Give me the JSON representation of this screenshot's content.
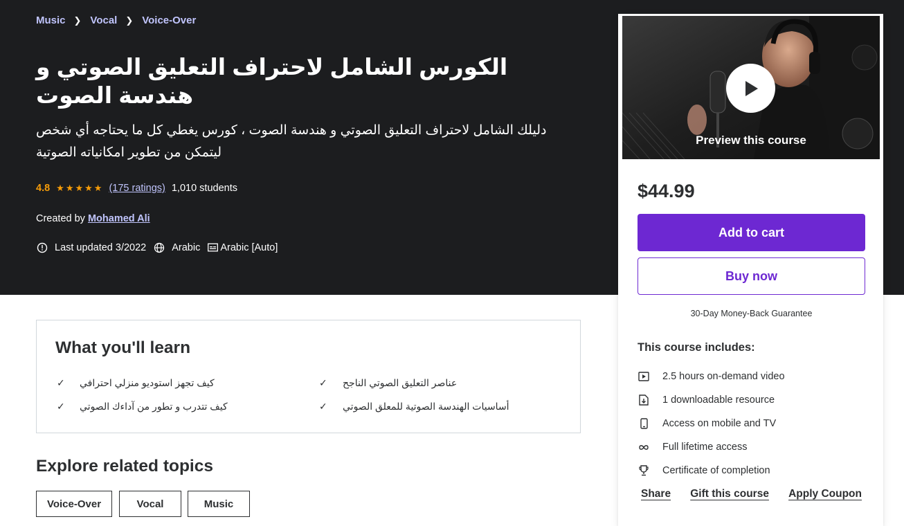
{
  "breadcrumb": [
    {
      "label": "Music"
    },
    {
      "label": "Vocal"
    },
    {
      "label": "Voice-Over"
    }
  ],
  "course": {
    "title": "الكورس الشامل لاحتراف التعليق الصوتي و هندسة الصوت",
    "subtitle": "دليلك الشامل لاحتراف التعليق الصوتي و هندسة الصوت ، كورس يغطي كل ما يحتاجه أي شخص ليتمكن من تطوير امكانياته الصوتية",
    "rating": "4.8",
    "stars": 5,
    "ratings_count": "(175 ratings)",
    "students": "1,010 students",
    "created_by_label": "Created by",
    "instructor": "Mohamed Ali",
    "last_updated": "Last updated 3/2022",
    "language": "Arabic",
    "captions": "Arabic [Auto]"
  },
  "sidebar": {
    "preview_label": "Preview this course",
    "price": "$44.99",
    "add_to_cart": "Add to cart",
    "buy_now": "Buy now",
    "guarantee": "30-Day Money-Back Guarantee",
    "includes_title": "This course includes:",
    "includes": [
      {
        "icon": "video-icon",
        "label": "2.5 hours on-demand video"
      },
      {
        "icon": "file-download-icon",
        "label": "1 downloadable resource"
      },
      {
        "icon": "mobile-icon",
        "label": "Access on mobile and TV"
      },
      {
        "icon": "infinity-icon",
        "label": "Full lifetime access"
      },
      {
        "icon": "trophy-icon",
        "label": "Certificate of completion"
      }
    ],
    "share": "Share",
    "gift": "Gift this course",
    "coupon": "Apply Coupon"
  },
  "learn": {
    "title": "What you'll learn",
    "items": [
      "عناصر التعليق الصوتي الناجح",
      "كيف تجهز استوديو منزلي احترافي",
      "أساسيات الهندسة الصوتية للمعلق الصوتي",
      "كيف تتدرب و تطور من آداءك الصوتي"
    ]
  },
  "topics": {
    "title": "Explore related topics",
    "items": [
      "Voice-Over",
      "Vocal",
      "Music"
    ]
  },
  "colors": {
    "hero_bg": "#1c1d1f",
    "link": "#c0c4fc",
    "star": "#f69c08",
    "primary": "#6d28d2"
  }
}
